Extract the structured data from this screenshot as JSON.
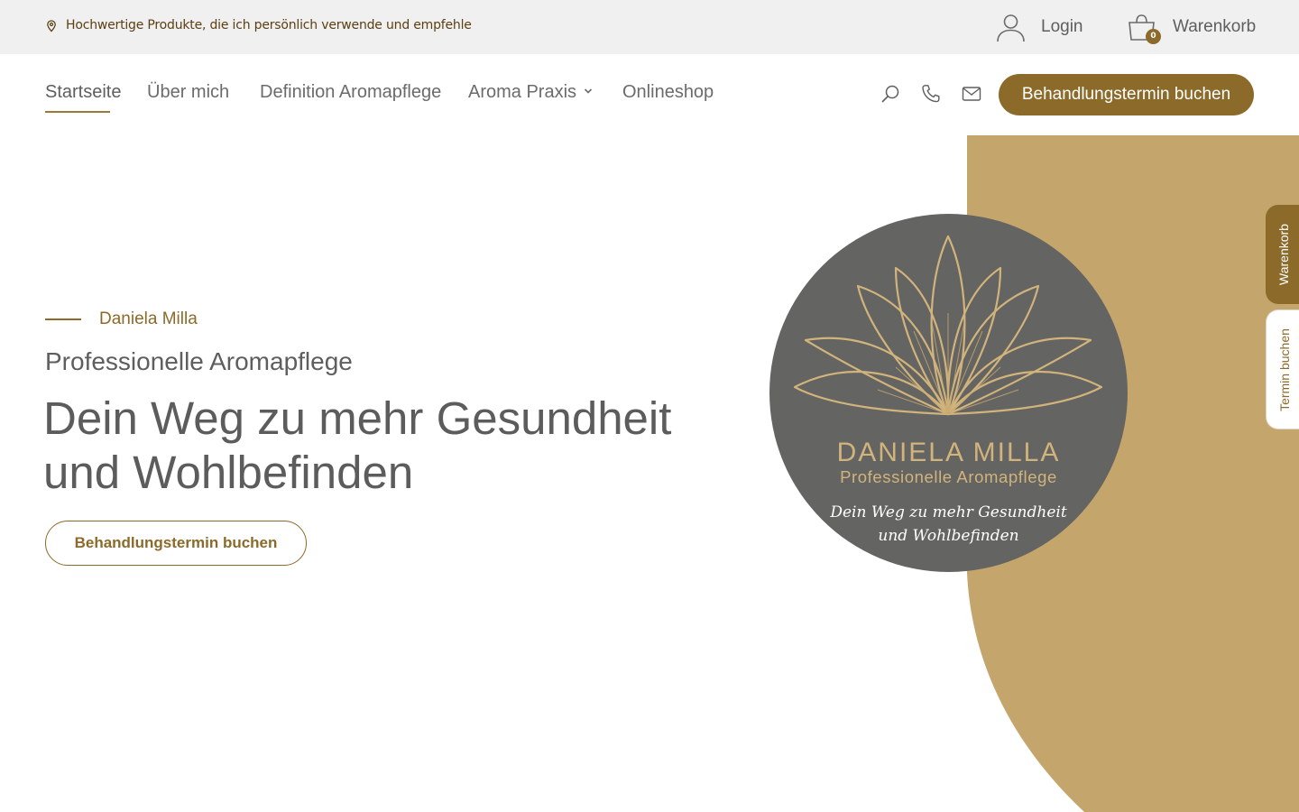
{
  "topbar": {
    "note": "Hochwertige Produkte, die ich persönlich verwende und empfehle",
    "login_label": "Login",
    "cart_label": "Warenkorb",
    "cart_count": "0"
  },
  "nav": {
    "items": [
      {
        "label": "Startseite",
        "active": true
      },
      {
        "label": "Über mich"
      },
      {
        "label": "Definition Aromapflege"
      },
      {
        "label": "Aroma Praxis",
        "has_dropdown": true
      },
      {
        "label": "Onlineshop"
      }
    ],
    "tools": [
      "search-icon",
      "phone-icon",
      "mail-icon"
    ],
    "cta_label": "Behandlungstermin buchen"
  },
  "hero": {
    "eyebrow": "Daniela Milla",
    "subtitle": "Professionelle Aromapflege",
    "headline": "Dein Weg zu mehr Gesundheit und Wohlbefinden",
    "button_label": "Behandlungstermin buchen"
  },
  "logo": {
    "name": "DANIELA MILLA",
    "tagline": "Professionelle Aromapflege",
    "slogan_line1": "Dein Weg zu mehr Gesundheit",
    "slogan_line2": "und Wohlbefinden"
  },
  "side_tabs": {
    "cart": "Warenkorb",
    "book": "Termin buchen"
  },
  "colors": {
    "accent": "#8c6a2a",
    "sand": "#c4a56c",
    "logo_bg": "#646462",
    "topbar_bg": "#f0f0f0"
  }
}
